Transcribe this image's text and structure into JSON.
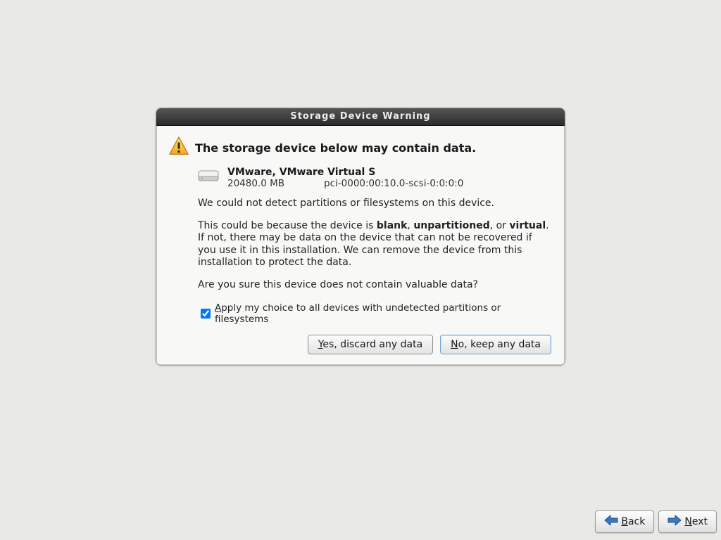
{
  "dialog": {
    "title": "Storage Device Warning",
    "headline": "The storage device below may contain data.",
    "device": {
      "name": "VMware, VMware Virtual S",
      "size": "20480.0 MB",
      "path": "pci-0000:00:10.0-scsi-0:0:0:0"
    },
    "p1": "We could not detect partitions or filesystems on this device.",
    "p2_pre": "This could be because the device is ",
    "p2_b1": "blank",
    "p2_s1": ", ",
    "p2_b2": "unpartitioned",
    "p2_s2": ", or ",
    "p2_b3": "virtual",
    "p2_post": ". If not, there may be data on the device that can not be recovered if you use it in this installation. We can remove the device from this installation to protect the data.",
    "p3": "Are you sure this device does not contain valuable data?",
    "checkbox_mn": "A",
    "checkbox_rest": "pply my choice to all devices with undetected partitions or filesystems",
    "btn_yes_mn": "Y",
    "btn_yes_rest": "es, discard any data",
    "btn_no_mn": "N",
    "btn_no_rest": "o, keep any data"
  },
  "nav": {
    "back_mn": "B",
    "back_rest": "ack",
    "next_mn": "N",
    "next_rest": "ext"
  }
}
